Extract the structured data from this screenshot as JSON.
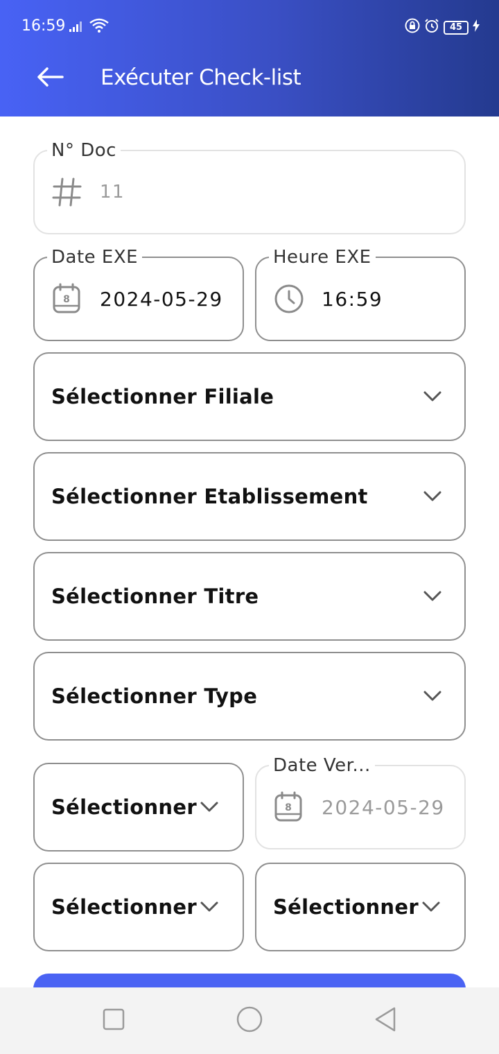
{
  "status_bar": {
    "time": "16:59",
    "battery": "45"
  },
  "header": {
    "title": "Exécuter Check-list",
    "back_icon": "arrow-left-icon",
    "background_color": "#4862f5"
  },
  "form": {
    "doc_number": {
      "label": "N° Doc",
      "value": "11",
      "icon": "hash-icon"
    },
    "date_exe": {
      "label": "Date EXE",
      "value": "2024-05-29",
      "icon": "calendar-icon"
    },
    "heure_exe": {
      "label": "Heure EXE",
      "value": "16:59",
      "icon": "clock-icon"
    },
    "filiale_select": {
      "label": "Sélectionner Filiale"
    },
    "etablissement_select": {
      "label": "Sélectionner Etablissement"
    },
    "titre_select": {
      "label": "Sélectionner Titre"
    },
    "type_select": {
      "label": "Sélectionner Type"
    },
    "select_1": {
      "label": "Sélectionner"
    },
    "date_ver": {
      "label": "Date Ver...",
      "value": "2024-05-29",
      "icon": "calendar-icon"
    },
    "select_2": {
      "label": "Sélectionner"
    },
    "select_3": {
      "label": "Sélectionner"
    }
  },
  "accent_color": "#4a63f3"
}
